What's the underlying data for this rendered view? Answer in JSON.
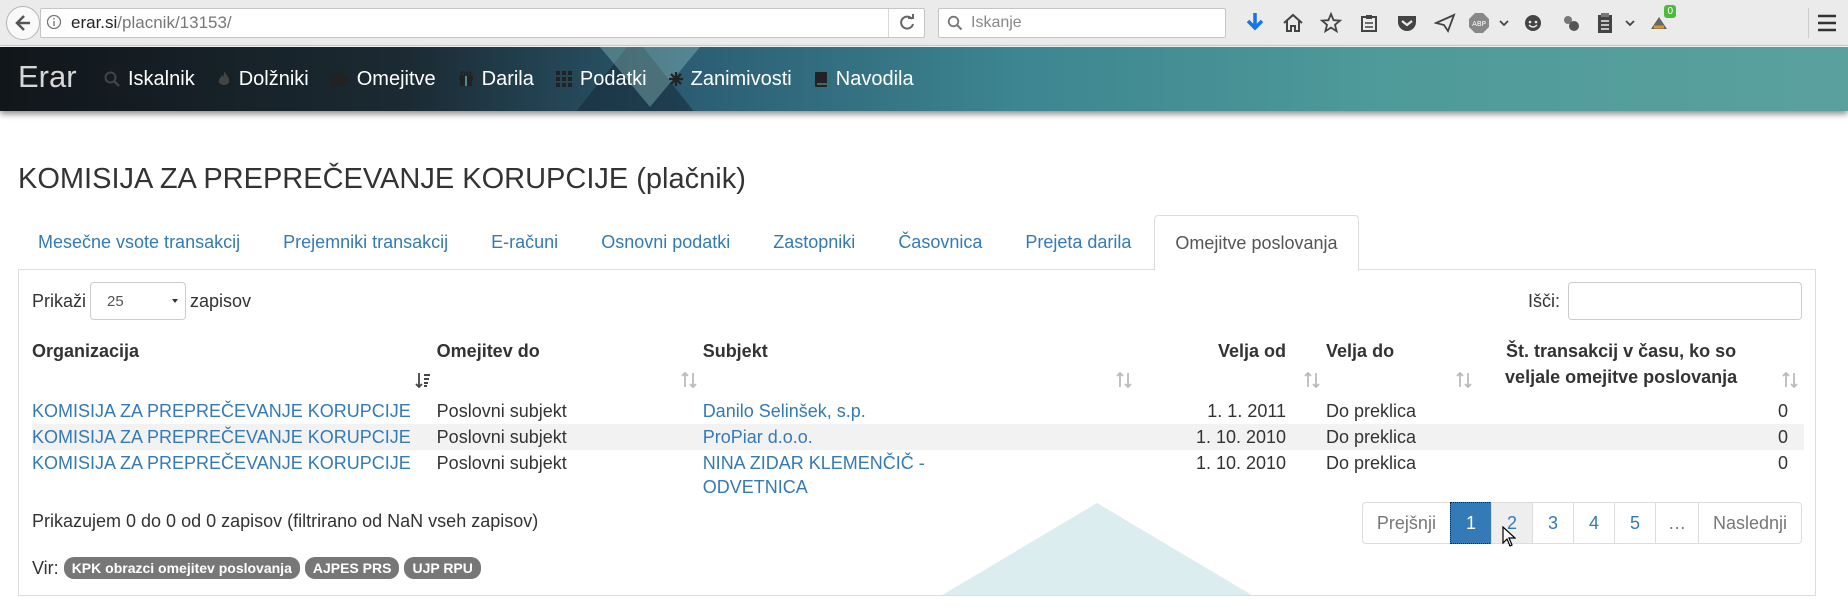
{
  "browser": {
    "url_host": "erar.si",
    "url_path": "/placnik/13153/",
    "search_placeholder": "Iskanje",
    "addon_badge": "0",
    "abp_label": "ABP"
  },
  "nav": {
    "brand": "Erar",
    "items": [
      {
        "label": "Iskalnik",
        "icon": "search-icon"
      },
      {
        "label": "Dolžniki",
        "icon": "fire-icon"
      },
      {
        "label": "Omejitve",
        "icon": "briefcase-icon"
      },
      {
        "label": "Darila",
        "icon": "gift-icon"
      },
      {
        "label": "Podatki",
        "icon": "grid-icon"
      },
      {
        "label": "Zanimivosti",
        "icon": "asterisk-icon"
      },
      {
        "label": "Navodila",
        "icon": "book-icon"
      }
    ]
  },
  "page": {
    "title": "KOMISIJA ZA PREPREČEVANJE KORUPCIJE (plačnik)"
  },
  "tabs": [
    {
      "label": "Mesečne vsote transakcij",
      "active": false
    },
    {
      "label": "Prejemniki transakcij",
      "active": false
    },
    {
      "label": "E-računi",
      "active": false
    },
    {
      "label": "Osnovni podatki",
      "active": false
    },
    {
      "label": "Zastopniki",
      "active": false
    },
    {
      "label": "Časovnica",
      "active": false
    },
    {
      "label": "Prejeta darila",
      "active": false
    },
    {
      "label": "Omejitve poslovanja",
      "active": true
    }
  ],
  "table_controls": {
    "show_label": "Prikaži",
    "page_size": "25",
    "records_label": "zapisov",
    "search_label": "Išči:",
    "search_value": ""
  },
  "table": {
    "columns": [
      "Organizacija",
      "Omejitev do",
      "Subjekt",
      "Velja od",
      "Velja do",
      "Št. transakcij v času, ko so veljale omejitve poslovanja"
    ],
    "rows": [
      {
        "org": "KOMISIJA ZA PREPREČEVANJE KORUPCIJE",
        "omejitev": "Poslovni subjekt",
        "subjekt": "Danilo Selinšek, s.p.",
        "od": "1. 1. 2011",
        "do": "Do preklica",
        "st": "0"
      },
      {
        "org": "KOMISIJA ZA PREPREČEVANJE KORUPCIJE",
        "omejitev": "Poslovni subjekt",
        "subjekt": "ProPiar d.o.o.",
        "od": "1. 10. 2010",
        "do": "Do preklica",
        "st": "0"
      },
      {
        "org": "KOMISIJA ZA PREPREČEVANJE KORUPCIJE",
        "omejitev": "Poslovni subjekt",
        "subjekt": "NINA ZIDAR KLEMENČIČ - ODVETNICA",
        "od": "1. 10. 2010",
        "do": "Do preklica",
        "st": "0"
      }
    ]
  },
  "info": "Prikazujem 0 do 0 od 0 zapisov (filtrirano od NaN vseh zapisov)",
  "pagination": {
    "prev": "Prejšnji",
    "pages": [
      "1",
      "2",
      "3",
      "4",
      "5"
    ],
    "ellipsis": "…",
    "next": "Naslednji",
    "active": "1"
  },
  "sources": {
    "label": "Vir:",
    "badges": [
      "KPK obrazci omejitev poslovanja",
      "AJPES PRS",
      "UJP RPU"
    ]
  },
  "colors": {
    "link": "#337ab7",
    "badge": "#777777",
    "active_page": "#337ab7"
  }
}
